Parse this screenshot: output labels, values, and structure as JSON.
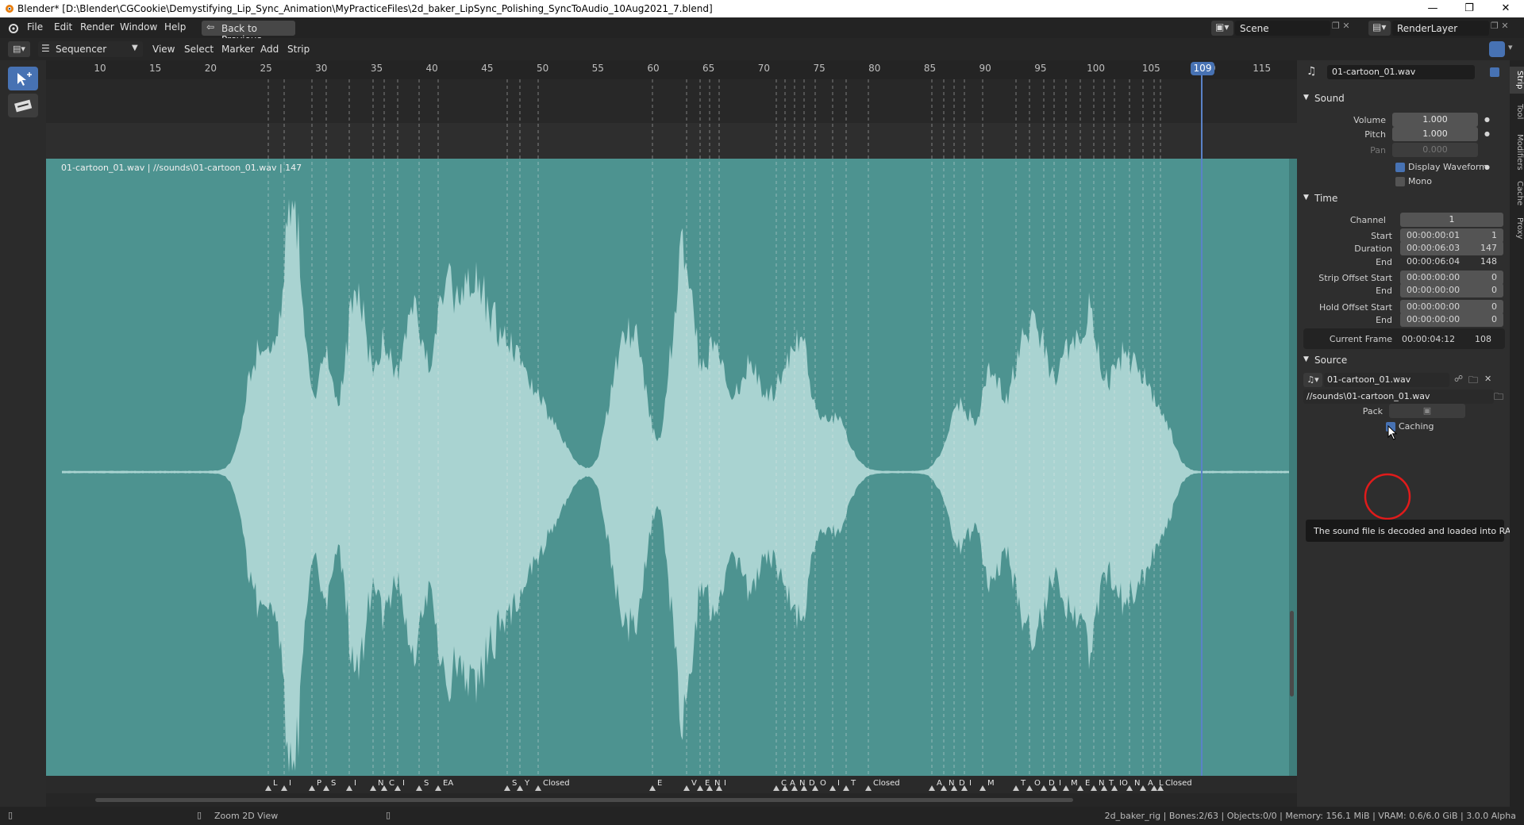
{
  "window": {
    "title": "Blender* [D:\\Blender\\CGCookie\\Demystifying_Lip_Sync_Animation\\MyPracticeFiles\\2d_baker_LipSync_Polishing_SyncToAudio_10Aug2021_7.blend]"
  },
  "menubar": {
    "items": [
      "File",
      "Edit",
      "Render",
      "Window",
      "Help"
    ],
    "back_label": "Back to Previous",
    "scene": "Scene",
    "render_layer": "RenderLayer"
  },
  "editor": {
    "type": "Sequencer",
    "menus": [
      "View",
      "Select",
      "Marker",
      "Add",
      "Strip"
    ]
  },
  "ruler": {
    "ticks": [
      "10",
      "15",
      "20",
      "25",
      "30",
      "35",
      "40",
      "45",
      "50",
      "55",
      "60",
      "65",
      "70",
      "75",
      "80",
      "85",
      "90",
      "95",
      "100",
      "105",
      "110",
      "115"
    ],
    "current_frame": "109"
  },
  "strip": {
    "label": "01-cartoon_01.wav | //sounds\\01-cartoon_01.wav | 147"
  },
  "markers": [
    {
      "t": "L"
    },
    {
      "t": "I"
    },
    {
      "t": "P"
    },
    {
      "t": "S"
    },
    {
      "t": "I"
    },
    {
      "t": "N"
    },
    {
      "t": "C"
    },
    {
      "t": "I"
    },
    {
      "t": "S"
    },
    {
      "t": "EA"
    },
    {
      "t": "S"
    },
    {
      "t": "Y"
    },
    {
      "t": "Closed"
    },
    {
      "t": "E"
    },
    {
      "t": "V"
    },
    {
      "t": "E"
    },
    {
      "t": "N"
    },
    {
      "t": "I"
    },
    {
      "t": "C"
    },
    {
      "t": "A"
    },
    {
      "t": "N"
    },
    {
      "t": "D"
    },
    {
      "t": "O"
    },
    {
      "t": "I"
    },
    {
      "t": "T"
    },
    {
      "t": "Closed"
    },
    {
      "t": "A"
    },
    {
      "t": "N"
    },
    {
      "t": "D"
    },
    {
      "t": "I"
    },
    {
      "t": "M"
    },
    {
      "t": "T"
    },
    {
      "t": "O"
    },
    {
      "t": "D"
    },
    {
      "t": "I"
    },
    {
      "t": "M"
    },
    {
      "t": "E"
    },
    {
      "t": "N"
    },
    {
      "t": "T"
    },
    {
      "t": "IO"
    },
    {
      "t": "N"
    },
    {
      "t": "A"
    },
    {
      "t": "L"
    },
    {
      "t": "Closed"
    }
  ],
  "sidebar": {
    "strip_name": "01-cartoon_01.wav",
    "tabs": [
      "Strip",
      "Tool",
      "Modifiers",
      "Cache",
      "Proxy"
    ],
    "sound": {
      "header": "Sound",
      "volume_label": "Volume",
      "volume": "1.000",
      "pitch_label": "Pitch",
      "pitch": "1.000",
      "pan_label": "Pan",
      "pan": "0.000",
      "display_waveform": "Display Waveform",
      "mono": "Mono"
    },
    "time": {
      "header": "Time",
      "channel_label": "Channel",
      "channel": "1",
      "start_label": "Start",
      "start_tc": "00:00:00:01",
      "start_f": "1",
      "duration_label": "Duration",
      "duration_tc": "00:00:06:03",
      "duration_f": "147",
      "end_label": "End",
      "end_tc": "00:00:06:04",
      "end_f": "148",
      "strip_offset_start_label": "Strip Offset Start",
      "sos_tc": "00:00:00:00",
      "sos_f": "0",
      "strip_offset_end_label": "End",
      "soe_tc": "00:00:00:00",
      "soe_f": "0",
      "hold_offset_start_label": "Hold Offset Start",
      "hos_tc": "00:00:00:00",
      "hos_f": "0",
      "hold_offset_end_label": "End",
      "hoe_tc": "00:00:00:00",
      "hoe_f": "0",
      "current_frame_label": "Current Frame",
      "cf_tc": "00:00:04:12",
      "cf_f": "108"
    },
    "source": {
      "header": "Source",
      "file": "01-cartoon_01.wav",
      "path": "//sounds\\01-cartoon_01.wav",
      "pack_label": "Pack",
      "caching_label": "Caching"
    },
    "tooltip": "The sound file is decoded and loaded into RAM."
  },
  "statusbar": {
    "zoom": "Zoom 2D View",
    "info": "2d_baker_rig | Bones:2/63 | Objects:0/0 | Memory: 156.1 MiB | VRAM: 0.6/6.0 GiB | 3.0.0 Alpha"
  },
  "colors": {
    "strip": "#4d9390",
    "waveform": "#a9d3d1",
    "playhead": "#4772b3"
  }
}
